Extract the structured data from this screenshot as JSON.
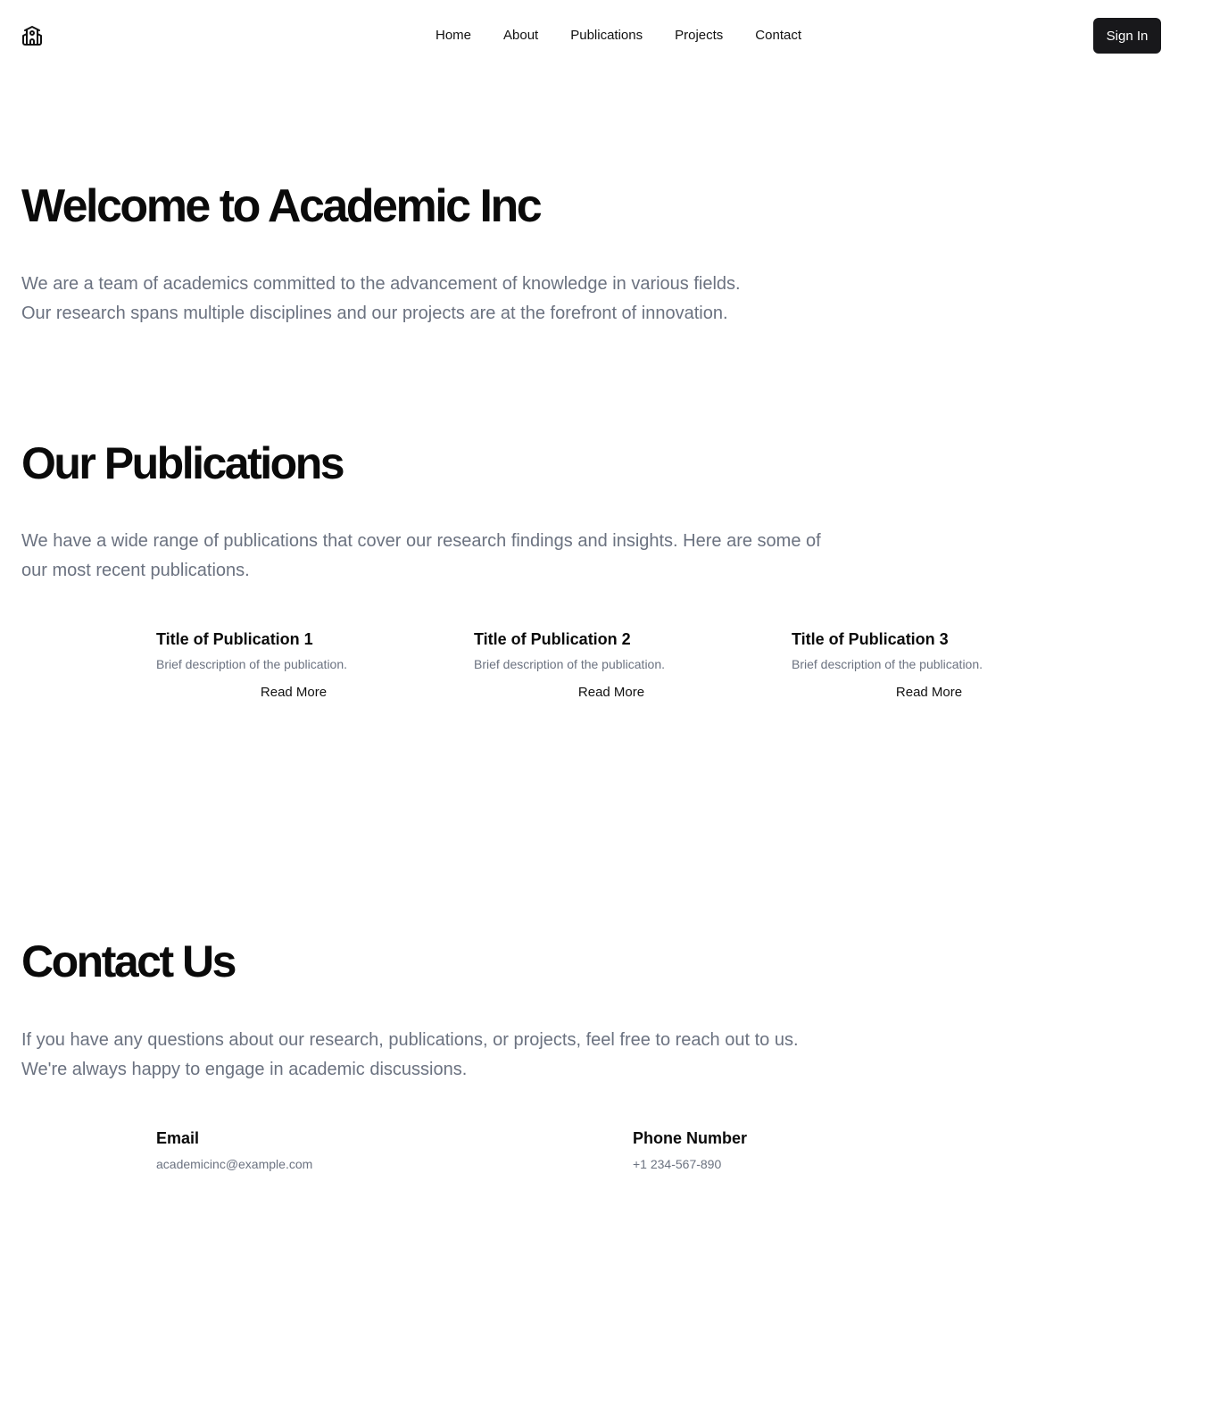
{
  "header": {
    "logo_icon": "school-building-icon",
    "nav": [
      "Home",
      "About",
      "Publications",
      "Projects",
      "Contact"
    ],
    "signin_label": "Sign In"
  },
  "hero": {
    "title": "Welcome to Academic Inc",
    "text_line1": "We are a team of academics committed to the advancement of knowledge in various fields.",
    "text_line2": "Our research spans multiple disciplines and our projects are at the forefront of innovation."
  },
  "publications": {
    "title": "Our Publications",
    "text": "We have a wide range of publications that cover our research findings and insights. Here are some of our most recent publications.",
    "items": [
      {
        "title": "Title of Publication 1",
        "description": "Brief description of the publication.",
        "link": "Read More"
      },
      {
        "title": "Title of Publication 2",
        "description": "Brief description of the publication.",
        "link": "Read More"
      },
      {
        "title": "Title of Publication 3",
        "description": "Brief description of the publication.",
        "link": "Read More"
      }
    ]
  },
  "contact": {
    "title": "Contact Us",
    "text": "If you have any questions about our research, publications, or projects, feel free to reach out to us. We're always happy to engage in academic discussions.",
    "email_label": "Email",
    "email_value": "academicinc@example.com",
    "phone_label": "Phone Number",
    "phone_value": "+1 234-567-890"
  },
  "colors": {
    "primary": "#18181b",
    "muted_text": "#6b7280",
    "background": "#ffffff"
  }
}
